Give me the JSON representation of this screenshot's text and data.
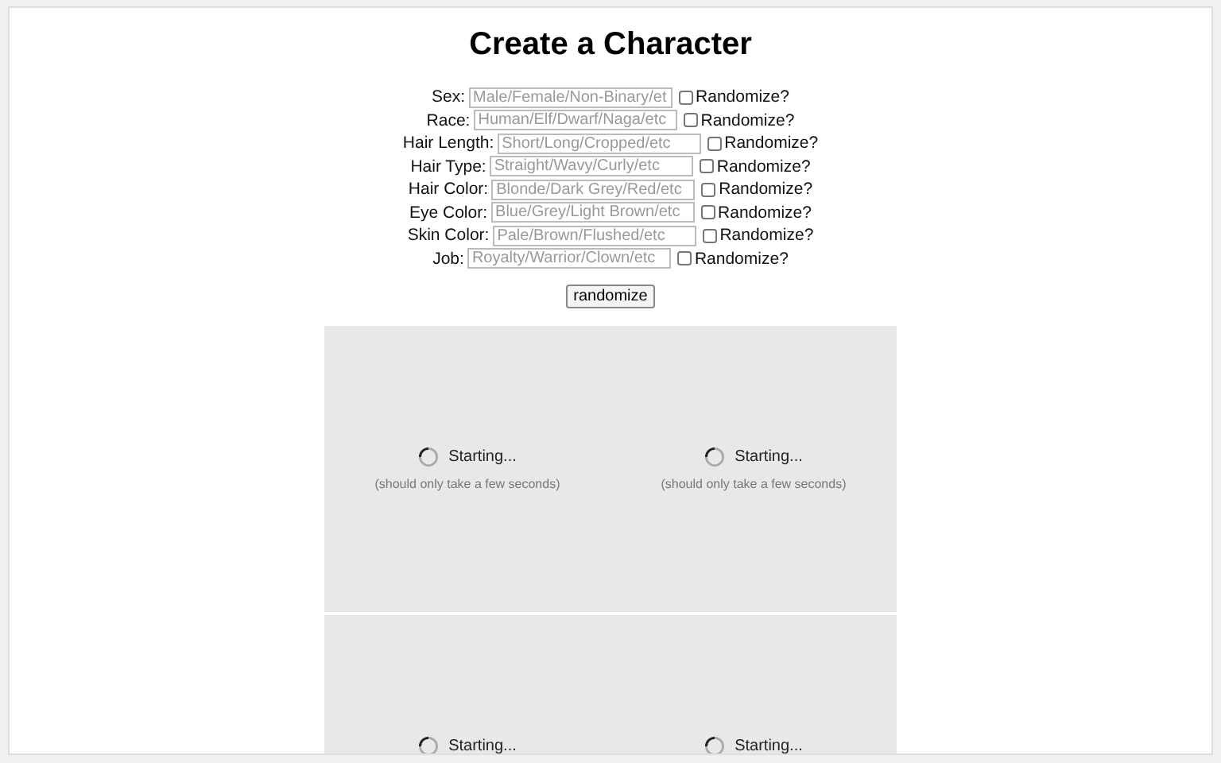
{
  "title": "Create a Character",
  "fields": [
    {
      "label": "Sex:",
      "placeholder": "Male/Female/Non-Binary/et",
      "randomize_label": "Randomize?",
      "checked": false
    },
    {
      "label": "Race:",
      "placeholder": "Human/Elf/Dwarf/Naga/etc",
      "randomize_label": "Randomize?",
      "checked": false
    },
    {
      "label": "Hair Length:",
      "placeholder": "Short/Long/Cropped/etc",
      "randomize_label": "Randomize?",
      "checked": false
    },
    {
      "label": "Hair Type:",
      "placeholder": "Straight/Wavy/Curly/etc",
      "randomize_label": "Randomize?",
      "checked": false
    },
    {
      "label": "Hair Color:",
      "placeholder": "Blonde/Dark Grey/Red/etc",
      "randomize_label": "Randomize?",
      "checked": false
    },
    {
      "label": "Eye Color:",
      "placeholder": "Blue/Grey/Light Brown/etc",
      "randomize_label": "Randomize?",
      "checked": false
    },
    {
      "label": "Skin Color:",
      "placeholder": "Pale/Brown/Flushed/etc",
      "randomize_label": "Randomize?",
      "checked": false
    },
    {
      "label": "Job:",
      "placeholder": "Royalty/Warrior/Clown/etc",
      "randomize_label": "Randomize?",
      "checked": false
    }
  ],
  "button": "randomize",
  "panels": [
    {
      "tiles": [
        {
          "status": "Starting...",
          "note": "(should only take a few seconds)"
        },
        {
          "status": "Starting...",
          "note": "(should only take a few seconds)"
        }
      ]
    },
    {
      "tiles": [
        {
          "status": "Starting..."
        },
        {
          "status": "Starting..."
        }
      ]
    }
  ]
}
